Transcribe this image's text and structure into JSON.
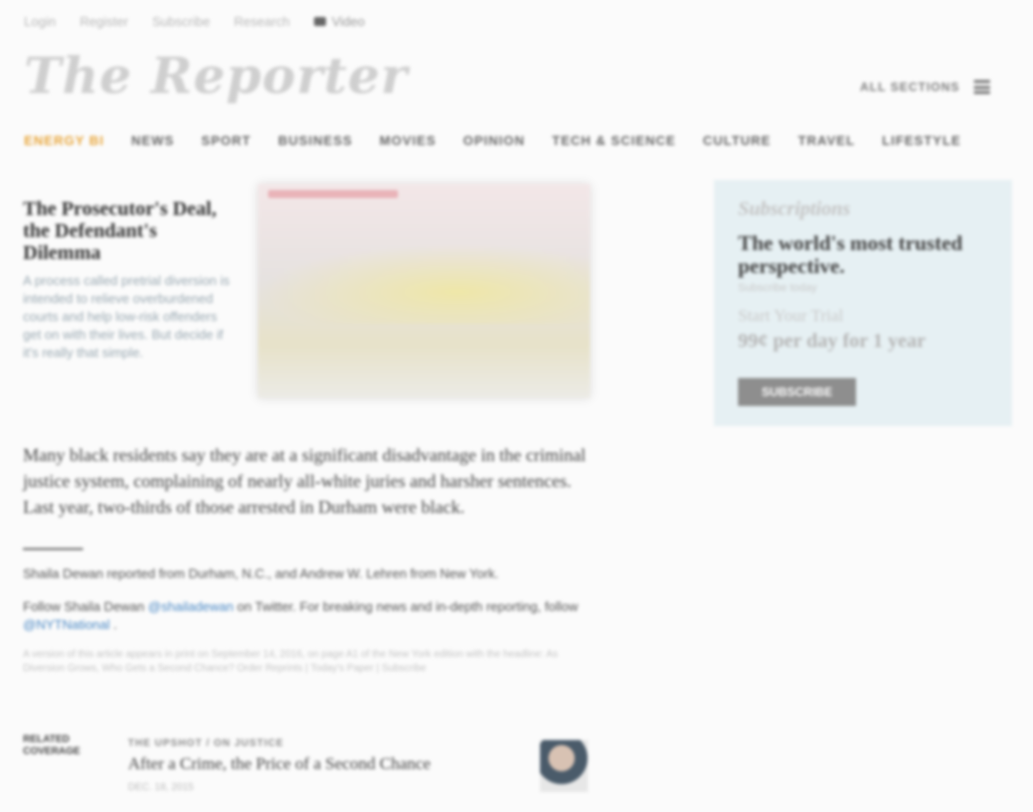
{
  "topnav": {
    "login": "Login",
    "register": "Register",
    "subscribe": "Subscribe",
    "research": "Research",
    "video": "Video"
  },
  "logo": "The Reporter",
  "header": {
    "all_sections": "ALL SECTIONS"
  },
  "sections": [
    "ENERGY BI",
    "NEWS",
    "SPORT",
    "BUSINESS",
    "MOVIES",
    "OPINION",
    "TECH & SCIENCE",
    "CULTURE",
    "TRAVEL",
    "LIFESTYLE"
  ],
  "feature": {
    "title": "The Prosecutor's Deal, the Defendant's Dilemma",
    "description": "A process called pretrial diversion is intended to relieve overburdened courts and help low-risk offenders get on with their lives. But decide if it's really that simple."
  },
  "promo": {
    "brand": "Subscriptions",
    "headline": "The world's most trusted perspective.",
    "small": "Subscribe today",
    "offer": "Start Your Trial",
    "price": "99¢ per day for 1 year",
    "button": "SUBSCRIBE"
  },
  "article": {
    "lead": "Many black residents say they are at a significant disadvantage in the criminal justice system, complaining of nearly all-white juries and harsher sentences. Last year, two-thirds of those arrested in Durham were black.",
    "credit": "Shaila Dewan reported from Durham, N.C., and Andrew W. Lehren from New York.",
    "follow_prefix": "Follow Shaila Dewan",
    "follow_handle": "@shailadewan",
    "follow_mid": " on Twitter. For breaking news and in-depth reporting, follow ",
    "follow_link": "@NYTNational",
    "follow_end": ".",
    "fine": "A version of this article appears in print on September 14, 2016, on page A1 of the New York edition with the headline: As Diversion Grows, Who Gets a Second Chance? Order Reprints | Today's Paper | Subscribe"
  },
  "related": {
    "label": "RELATED COVERAGE",
    "kicker": "THE UPSHOT  /  ON JUSTICE",
    "title": "After a Crime, the Price of a Second Chance",
    "date": "DEC. 18, 2015"
  },
  "colors": {
    "accent": "#e8a63b",
    "promo_bg": "#e6f0f3",
    "link": "#4b89c5"
  }
}
